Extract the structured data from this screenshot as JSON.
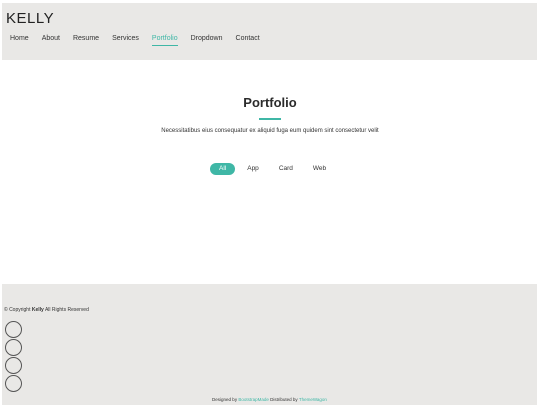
{
  "header": {
    "logo": "KELLY",
    "nav": [
      "Home",
      "About",
      "Resume",
      "Services",
      "Portfolio",
      "Dropdown",
      "Contact"
    ],
    "active_nav": "Portfolio"
  },
  "portfolio": {
    "title": "Portfolio",
    "description": "Necessitatibus eius consequatur ex aliquid fuga eum quidem sint consectetur velit",
    "filters": [
      "All",
      "App",
      "Card",
      "Web"
    ],
    "active_filter": "All"
  },
  "footer": {
    "copyright_prefix": "© Copyright",
    "copyright_name": "Kelly",
    "copyright_suffix": "All Rights Reserved",
    "social_count": 4,
    "designed_by_text": "Designed by",
    "designed_by_link": "BootstrapMade",
    "distributed_by_text": "Distributed by",
    "distributed_by_link": "ThemeWagon"
  },
  "colors": {
    "accent": "#3fb7a6",
    "header_bg": "#e9e8e6",
    "footer_bg": "#e9e8e6"
  }
}
